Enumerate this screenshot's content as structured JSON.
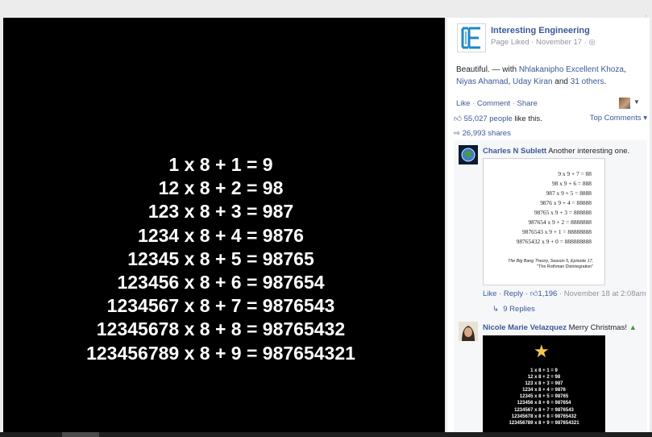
{
  "photo": {
    "equations": [
      "1 x 8 + 1 = 9",
      "12 x 8 + 2 = 98",
      "123 x 8 + 3 = 987",
      "1234 x 8 + 4 = 9876",
      "12345 x 8 + 5 = 98765",
      "123456 x 8 + 6 = 987654",
      "1234567 x 8 + 7 = 9876543",
      "12345678 x 8 + 8 = 98765432",
      "123456789 x 8 + 9 = 987654321"
    ]
  },
  "panel": {
    "page_name": "Interesting Engineering",
    "page_meta": "Page Liked · November 17 · ",
    "caption": {
      "text": "Beautiful. — with ",
      "person1": "Nhlakanipho Excellent Khoza",
      "sep1": ", ",
      "person2": "Niyas Ahamad",
      "sep2": ", ",
      "person3": "Uday Kiran",
      "and": " and ",
      "others": "31 others",
      "end": "."
    },
    "actions": {
      "like": "Like",
      "comment": "Comment",
      "share": "Share",
      "dot": " · "
    },
    "likes_count": "55,027 people",
    "likes_suffix": " like this.",
    "top_comments": "Top Comments ▾",
    "shares": "26,993 shares",
    "comments": [
      {
        "author": "Charles N Sublett",
        "text": " Another interesting one.",
        "image_lines": [
          "9 x 9 + 7  =  88",
          "98 x 9 + 6  =  888",
          "987 x 9 + 5  =  8888",
          "9876 x 9 + 4  =  88888",
          "98765 x 9 + 3  =  888888",
          "987654 x 9 + 2  =  8888888",
          "9876543 x 9 + 1  =  88888888",
          "98765432 x 9 + 0  =  888888888"
        ],
        "image_source_1": "The Big Bang Theory, Season 5, Episode 17,",
        "image_source_2": "\"The Rothman Disintegration\"",
        "reply": "Like · Reply · ",
        "reply_likes": "1,196",
        "time": " · November 18 at 2:08am",
        "replies": "9 Replies"
      },
      {
        "author": "Nicole Marie Velazquez",
        "text": " Merry Christmas!",
        "image_lines": [
          "1 x 8 + 1 = 9",
          "12 x 8 + 2 = 98",
          "123 x 8 + 3 = 987",
          "1234 x 8 + 4 = 9876",
          "12345 x 8 + 5 = 98765",
          "123456 x 8 + 6 = 987654",
          "1234567 x 8 + 7 = 9876543",
          "12345678 x 8 + 8 = 98765432",
          "123456789 x 8 + 9 = 987654321"
        ]
      }
    ]
  },
  "colors": {
    "link": "#3b5998",
    "meta": "#90949c",
    "photo_bg": "#000000"
  }
}
